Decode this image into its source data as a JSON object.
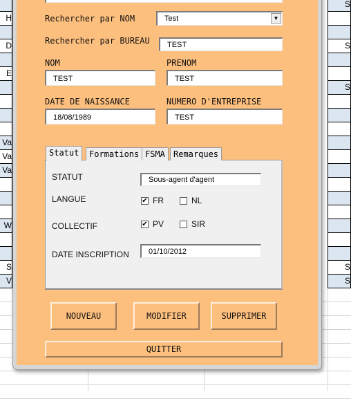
{
  "sheet": {
    "left_cells": [
      {
        "row": 1,
        "text": "H"
      },
      {
        "row": 3,
        "text": "D"
      },
      {
        "row": 5,
        "text": "E"
      },
      {
        "row": 10,
        "text": "Va"
      },
      {
        "row": 11,
        "text": "Va"
      },
      {
        "row": 12,
        "text": "Va"
      },
      {
        "row": 16,
        "text": "W"
      },
      {
        "row": 19,
        "text": "S"
      },
      {
        "row": 20,
        "text": "V"
      }
    ],
    "right_cells": [
      {
        "row": 0,
        "text": "Se"
      },
      {
        "row": 3,
        "text": "Se"
      },
      {
        "row": 6,
        "text": "Se"
      },
      {
        "row": 19,
        "text": "Se"
      },
      {
        "row": 20,
        "text": "Se"
      }
    ]
  },
  "form": {
    "search_name_label": "Rechercher par NOM",
    "search_name_value": "Test",
    "search_bureau_label": "Rechercher par BUREAU",
    "search_bureau_value": "TEST",
    "nom_label": "NOM",
    "nom_value": "TEST",
    "prenom_label": "PRENOM",
    "prenom_value": "TEST",
    "dob_label": "DATE DE NAISSANCE",
    "dob_value": "18/08/1989",
    "company_label": "NUMERO D'ENTREPRISE",
    "company_value": "TEST",
    "tabs": [
      "Statut",
      "Formations",
      "FSMA",
      "Remarques"
    ],
    "statut_label": "STATUT",
    "statut_value": "Sous-agent d'agent",
    "langue_label": "LANGUE",
    "fr_label": "FR",
    "fr_checked": true,
    "nl_label": "NL",
    "nl_checked": false,
    "collectif_label": "COLLECTIF",
    "pv_label": "PV",
    "pv_checked": true,
    "sir_label": "SIR",
    "sir_checked": false,
    "inscription_label": "DATE INSCRIPTION",
    "inscription_value": "01/10/2012",
    "buttons": {
      "new": "NOUVEAU",
      "modify": "MODIFIER",
      "delete": "SUPPRIMER",
      "quit": "QUITTER"
    }
  },
  "colors": {
    "dialog_bg": "#fdbf7e",
    "row_band": "#dce6f1"
  }
}
